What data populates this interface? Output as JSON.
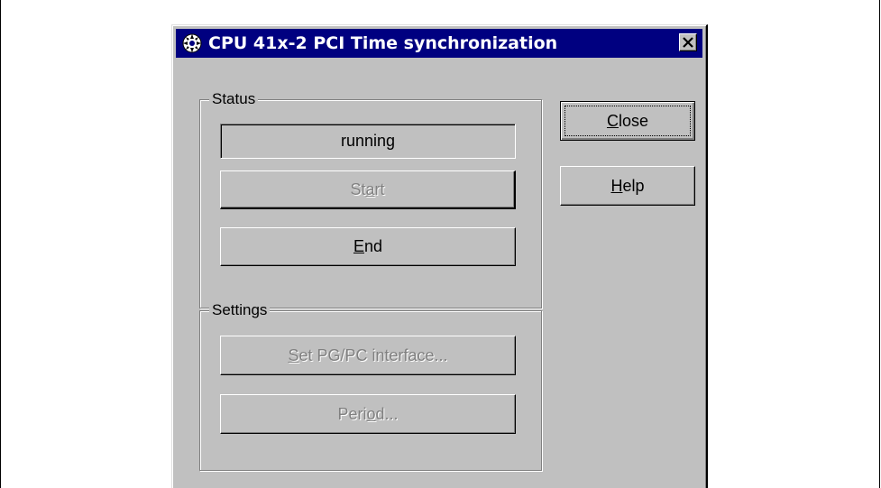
{
  "window": {
    "title": "CPU 41x-2 PCI Time synchronization",
    "close_glyph": "✕"
  },
  "status_group": {
    "label": "Status",
    "status_value": "running",
    "start_button": {
      "pre": "St",
      "accel": "a",
      "post": "rt",
      "enabled": false
    },
    "end_button": {
      "pre": "",
      "accel": "E",
      "post": "nd",
      "enabled": true
    }
  },
  "settings_group": {
    "label": "Settings",
    "interface_button": {
      "pre": "",
      "accel": "S",
      "post": "et PG/PC interface...",
      "enabled": false
    },
    "period_button": {
      "pre": "Peri",
      "accel": "o",
      "post": "d...",
      "enabled": false
    }
  },
  "side_buttons": {
    "close_button": {
      "pre": "",
      "accel": "C",
      "post": "lose",
      "is_default": true
    },
    "help_button": {
      "pre": "",
      "accel": "H",
      "post": "elp"
    }
  },
  "colors": {
    "title_bar": "#000080",
    "dialog_face": "#c0c0c0",
    "disabled_text": "#808080"
  },
  "icons": {
    "title_icon": "time-sync-icon",
    "close_icon": "close-icon"
  }
}
